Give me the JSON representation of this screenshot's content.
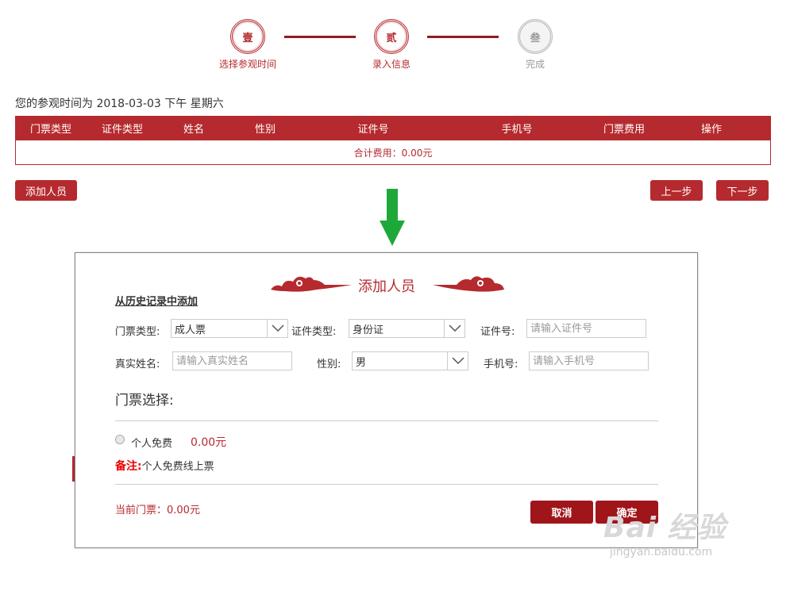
{
  "steps": [
    {
      "glyph": "壹",
      "label": "选择参观时间",
      "state": "active"
    },
    {
      "glyph": "贰",
      "label": "录入信息",
      "state": "active"
    },
    {
      "glyph": "叁",
      "label": "完成",
      "state": "pending"
    }
  ],
  "visit_time_text": "您的参观时间为 2018-03-03 下午 星期六",
  "table": {
    "headers": [
      "门票类型",
      "证件类型",
      "姓名",
      "性别",
      "证件号",
      "手机号",
      "门票费用",
      "操作"
    ],
    "total_text": "合计费用：0.00元"
  },
  "buttons": {
    "add_person": "添加人员",
    "prev": "上一步",
    "next": "下一步"
  },
  "modal": {
    "title": "添加人员",
    "history_link": "从历史记录中添加",
    "ticket_type_label": "门票类型:",
    "ticket_type_value": "成人票",
    "id_type_label": "证件类型:",
    "id_type_value": "身份证",
    "id_no_label": "证件号:",
    "id_no_placeholder": "请输入证件号",
    "real_name_label": "真实姓名:",
    "real_name_placeholder": "请输入真实姓名",
    "gender_label": "性别:",
    "gender_value": "男",
    "phone_label": "手机号:",
    "phone_placeholder": "请输入手机号",
    "ticket_section_title": "门票选择:",
    "ticket_option_name": "个人免费",
    "ticket_option_price": "0.00元",
    "note_label": "备注:",
    "note_text": "个人免费线上票",
    "current_ticket": "当前门票：0.00元",
    "cancel": "取消",
    "confirm": "确定"
  },
  "watermark": {
    "logo": "Bai 经验",
    "url": "jingyan.baidu.com"
  },
  "colors": {
    "brand_red": "#b52a2e",
    "dark_red": "#a0151a",
    "arrow_green": "#1fa83a"
  }
}
